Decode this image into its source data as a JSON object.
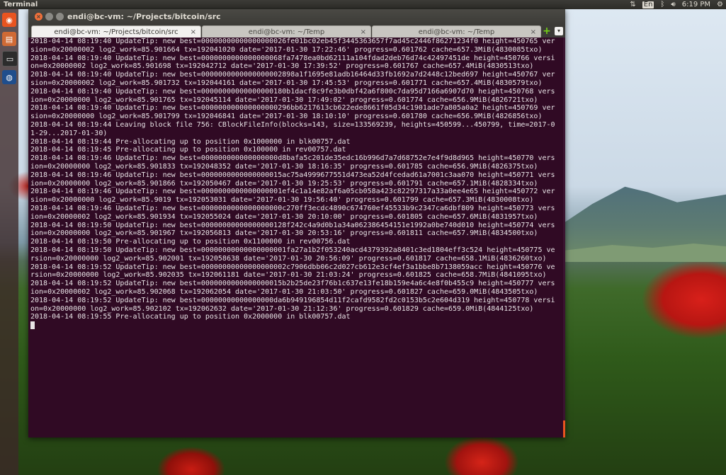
{
  "top_panel": {
    "app_title": "Terminal",
    "keyboard": "En",
    "time": "6:19 PM"
  },
  "window": {
    "title": "endi@bc-vm: ~/Projects/bitcoin/src",
    "tabs": [
      {
        "label": "endi@bc-vm: ~/Projects/bitcoin/src",
        "active": true
      },
      {
        "label": "endi@bc-vm: ~/Temp",
        "active": false
      },
      {
        "label": "endi@bc-vm: ~/Temp",
        "active": false
      }
    ],
    "tab_close": "×",
    "new_tab": "+",
    "tab_menu": "▾"
  },
  "terminal": {
    "lines": [
      "2018-04-14 08:19:40 UpdateTip: new best=00000000000000000026fe01bc02eb45f3445363657f7ad45c2446f86271234f0 height=450765 version=0x20000002 log2_work=85.901664 tx=192041020 date='2017-01-30 17:22:46' progress=0.601762 cache=657.3MiB(4830085txo)",
      "2018-04-14 08:19:40 UpdateTip: new best=0000000000000000068fa7478ea0bd62111a104fdad2deb76d74c42497451de height=450766 version=0x20000002 log2_work=85.901698 tx=192042712 date='2017-01-30 17:39:52' progress=0.601767 cache=657.4MiB(4830513txo)",
      "2018-04-14 08:19:40 UpdateTip: new best=0000000000000000002898a1f1695e81adb16464d33fb1692a7d2448c12bed697 height=450767 version=0x20000002 log2_work=85.901732 tx=192044161 date='2017-01-30 17:45:53' progress=0.601771 cache=657.4MiB(4830579txo)",
      "2018-04-14 08:19:40 UpdateTip: new best=00000000000000000180b1dacf8c9fe3b0dbf42a6f800c7da95d7166a6907d70 height=450768 version=0x20000000 log2_work=85.901765 tx=192045114 date='2017-01-30 17:49:02' progress=0.601774 cache=656.9MiB(4826721txo)",
      "2018-04-14 08:19:40 UpdateTip: new best=000000000000000000296bb6217613cb622ede8661f05d34c1901ade7a805a0a2 height=450769 version=0x20000000 log2_work=85.901799 tx=192046841 date='2017-01-30 18:10:10' progress=0.601780 cache=656.9MiB(4826856txo)",
      "2018-04-14 08:19:44 Leaving block file 756: CBlockFileInfo(blocks=143, size=133569239, heights=450599...450799, time=2017-01-29...2017-01-30)",
      "2018-04-14 08:19:44 Pre-allocating up to position 0x1000000 in blk00757.dat",
      "2018-04-14 08:19:45 Pre-allocating up to position 0x100000 in rev00757.dat",
      "2018-04-14 08:19:46 UpdateTip: new best=000000000000000000d8bafa5c201de35edc16b996d7a7d68752e7e4f9d8d965 height=450770 version=0x20000000 log2_work=85.901833 tx=192048352 date='2017-01-30 18:16:35' progress=0.601785 cache=656.9MiB(4826375txo)",
      "2018-04-14 08:19:46 UpdateTip: new best=0000000000000000015ac75a4999677551d473ea52d4fcedad61a7001c3aa070 height=450771 version=0x20000000 log2_work=85.901866 tx=192050467 date='2017-01-30 19:25:53' progress=0.601791 cache=657.1MiB(4828334txo)",
      "2018-04-14 08:19:46 UpdateTip: new best=0000000000000000001ef4c1a14e82af6a05cb058a423c82297317a33a0ee4e65 height=450772 version=0x20000000 log2_work=85.9019 tx=192053031 date='2017-01-30 19:56:40' progress=0.601799 cache=657.3MiB(4830008txo)",
      "2018-04-14 08:19:46 UpdateTip: new best=0000000000000000000c270ff3ecdc4890c674760ef45533b9c2347ca6dbf809 height=450773 version=0x20000002 log2_work=85.901934 tx=192055024 date='2017-01-30 20:10:00' progress=0.601805 cache=657.6MiB(4831957txo)",
      "2018-04-14 08:19:50 UpdateTip: new best=00000000000000000128f242c4a9d0b1a34a062386454151e1992a0be740d010 height=450774 version=0x20000000 log2_work=85.901967 tx=192056813 date='2017-01-30 20:53:16' progress=0.601811 cache=657.9MiB(4834500txo)",
      "2018-04-14 08:19:50 Pre-allocating up to position 0x1100000 in rev00756.dat",
      "2018-04-14 08:19:50 UpdateTip: new best=00000000000000000001fa27a1b2f053240acd4379392a8401c3ed1804eff3c524 height=450775 version=0x20000000 log2_work=85.902001 tx=192058638 date='2017-01-30 20:56:09' progress=0.601817 cache=658.1MiB(4836260txo)",
      "2018-04-14 08:19:52 UpdateTip: new best=00000000000000000002c7906dbb06c2d027cb612e3cf4ef3a1bbe8b7138059acc height=450776 version=0x20000000 log2_work=85.902035 tx=192061181 date='2017-01-30 21:03:24' progress=0.601825 cache=658.7MiB(4841095txo)",
      "2018-04-14 08:19:52 UpdateTip: new best=0000000000000000015b2b25de23f76b1c637e13fe18b159e4a6c4e8f0b455c9 height=450777 version=0x20000002 log2_work=85.902068 tx=192062054 date='2017-01-30 21:03:50' progress=0.601827 cache=659.0MiB(4843505txo)",
      "2018-04-14 08:19:52 UpdateTip: new best=00000000000000000da6b949196854d11f2cafd9582fd2c0153b5c2e604d319 height=450778 version=0x20000000 log2_work=85.902102 tx=192062632 date='2017-01-30 21:12:36' progress=0.601829 cache=659.0MiB(4844125txo)",
      "2018-04-14 08:19:55 Pre-allocating up to position 0x2000000 in blk00757.dat"
    ]
  }
}
